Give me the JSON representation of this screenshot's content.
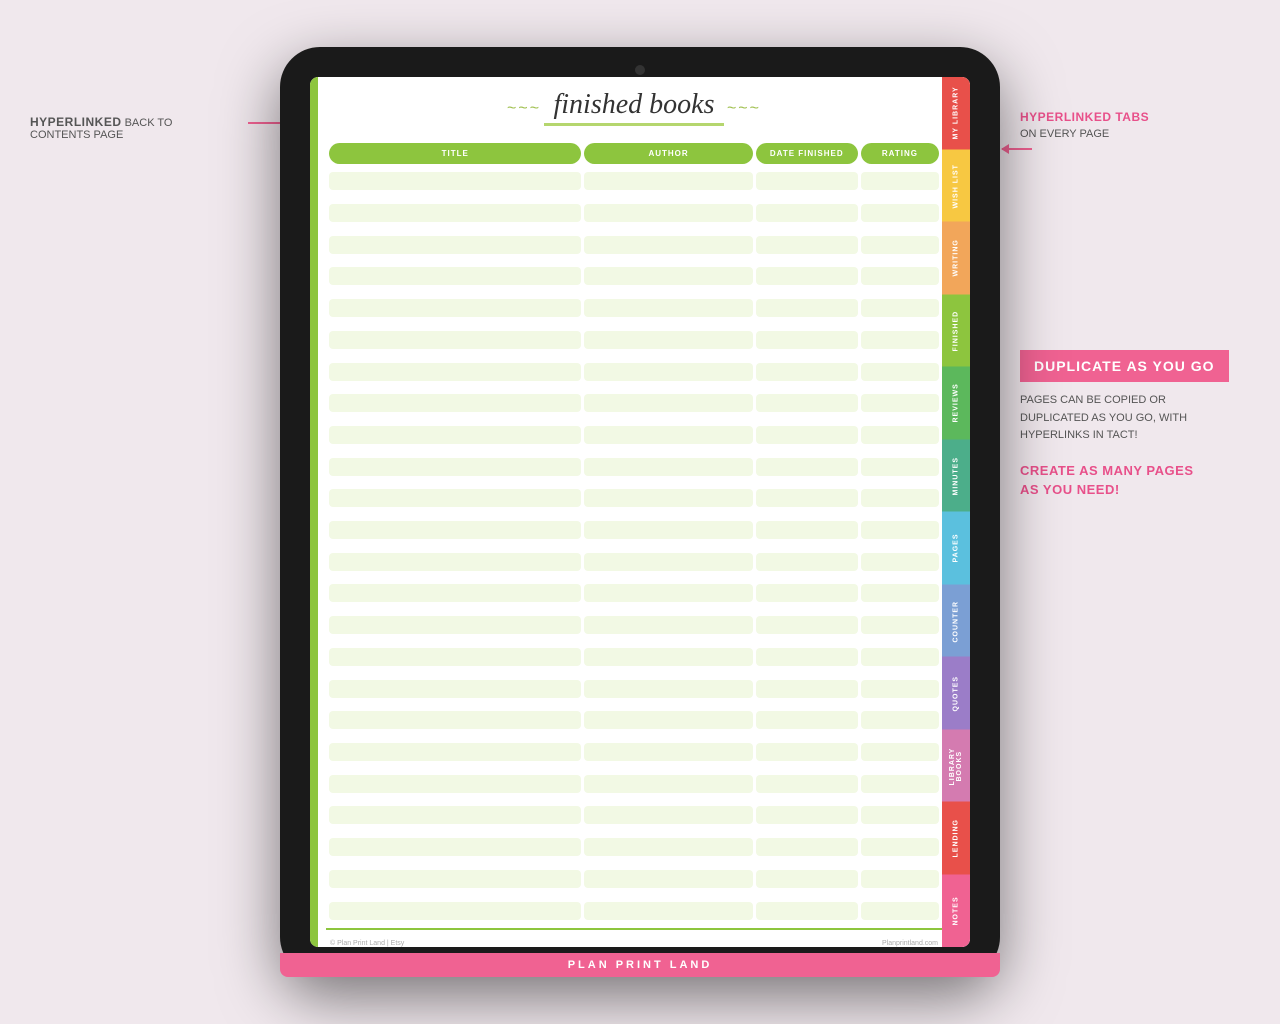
{
  "page": {
    "title": "finished books",
    "title_decoration": "~~",
    "footer_left": "© Plan Print Land | Etsy",
    "footer_right": "Planprintland.com"
  },
  "brand": "PLAN PRINT LAND",
  "table": {
    "headers": [
      "TITLE",
      "AUTHOR",
      "DATE FINISHED",
      "RATING"
    ],
    "rows": 24
  },
  "tabs": [
    {
      "label": "MY LIBRARY",
      "class": "tab-my-library"
    },
    {
      "label": "WISH LIST",
      "class": "tab-wish-list"
    },
    {
      "label": "WRITING",
      "class": "tab-writing"
    },
    {
      "label": "FINISHED",
      "class": "tab-finished"
    },
    {
      "label": "REVIEWS",
      "class": "tab-reviews"
    },
    {
      "label": "MINUTES",
      "class": "tab-minutes"
    },
    {
      "label": "PAGES",
      "class": "tab-pages"
    },
    {
      "label": "COUNTER",
      "class": "tab-counter"
    },
    {
      "label": "QUOTES",
      "class": "tab-quotes"
    },
    {
      "label": "LIBRARY BOOKS",
      "class": "tab-library-books"
    },
    {
      "label": "LENDING",
      "class": "tab-lending"
    },
    {
      "label": "NOTES",
      "class": "tab-notes"
    }
  ],
  "annotations": {
    "left": {
      "bold": "HYPERLINKED",
      "text": " BACK TO\nCONTENTS PAGE"
    },
    "right_top": {
      "bold": "HYPERLINKED TABS",
      "text": "ON EVERY PAGE"
    },
    "right_duplicate": {
      "box_label": "DUPLICATE AS YOU GO",
      "line1": "PAGES CAN BE COPIED OR",
      "line2": "DUPLICATED AS YOU GO, WITH",
      "line3": "HYPERLINKS IN TACT!",
      "create_label": "CREATE AS MANY PAGES\nAS YOU NEED!"
    }
  }
}
